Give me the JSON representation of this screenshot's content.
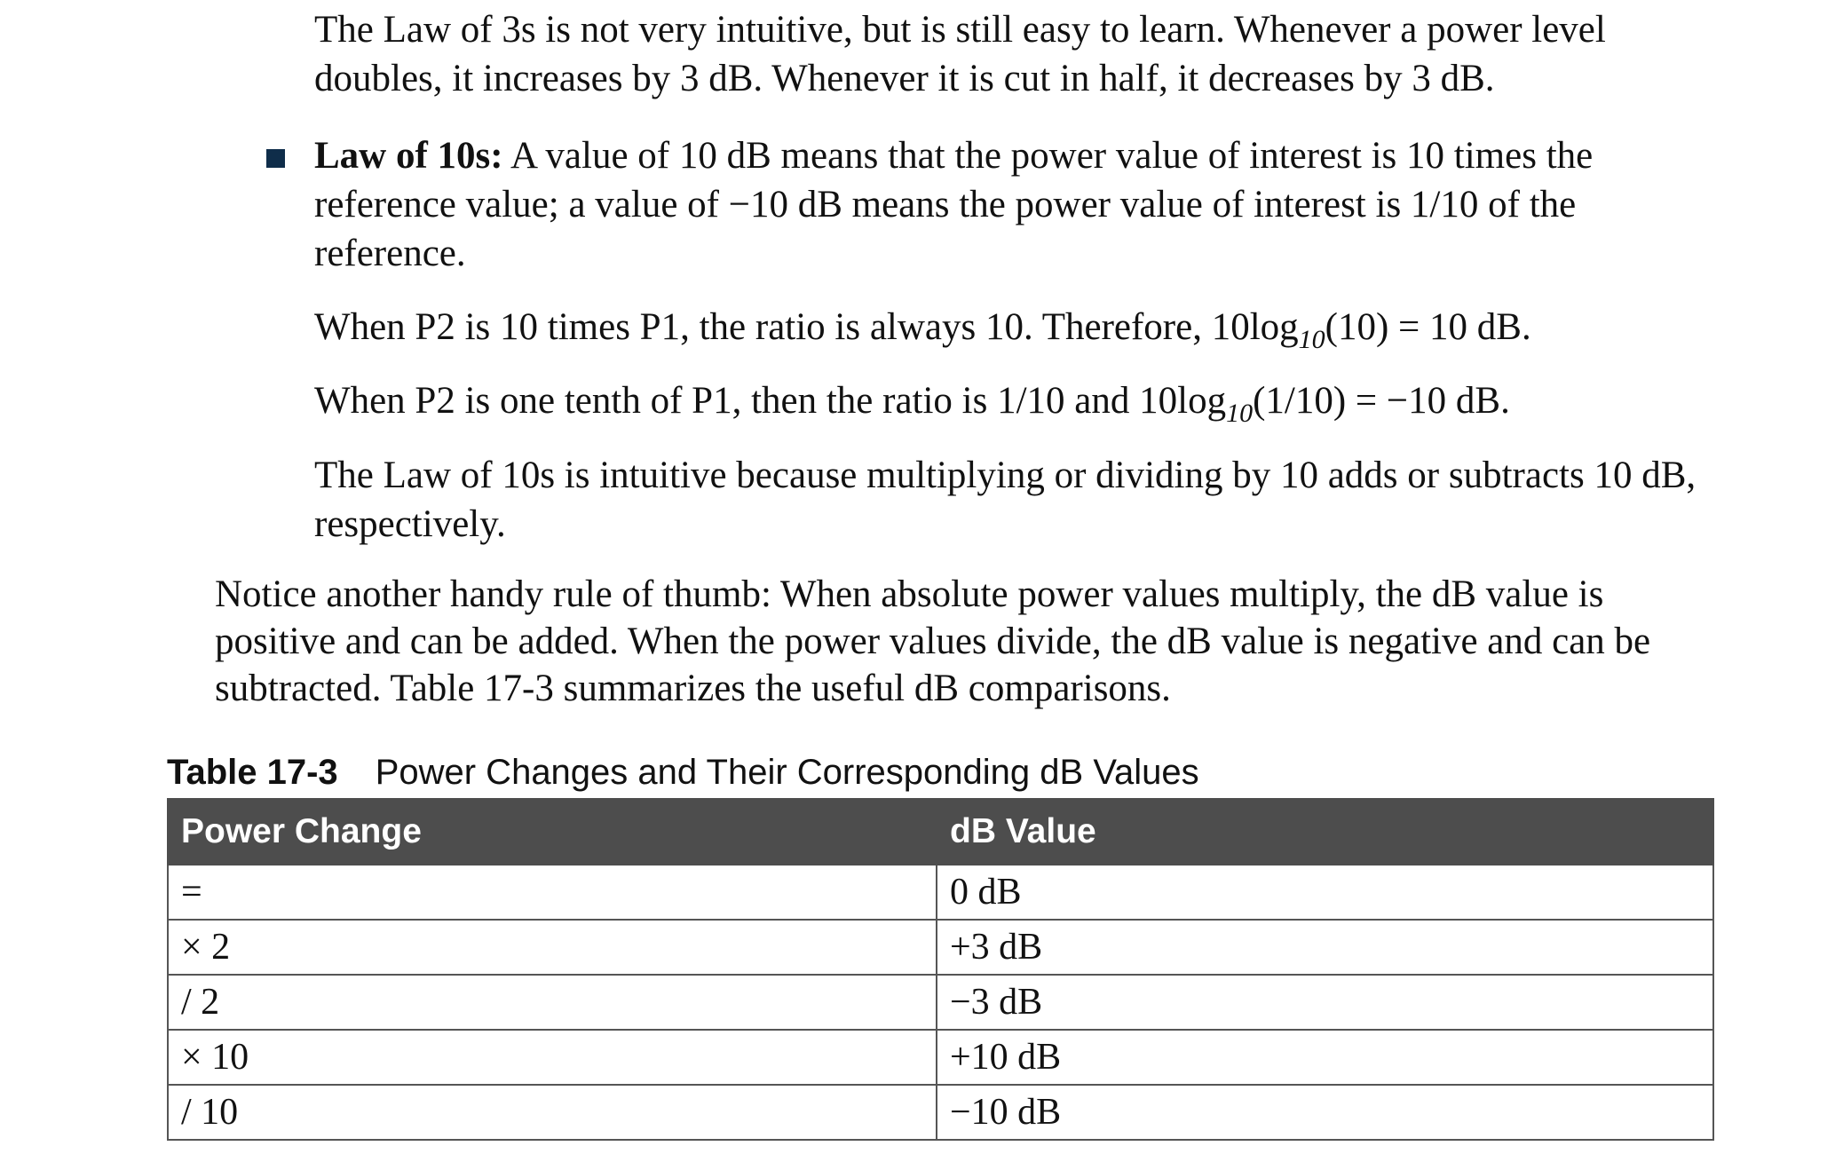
{
  "paragraphs": {
    "law3s_summary": "The Law of 3s is not very intuitive, but is still easy to learn. Whenever a power level doubles, it increases by 3 dB. Whenever it is cut in half, it decreases by 3 dB.",
    "law10s_term": "Law of 10s:",
    "law10s_def": " A value of 10 dB means that the power value of interest is 10 times the reference value; a value of −10 dB means the power value of interest is 1/10 of the reference.",
    "times10_pre": "When P2 is 10 times P1, the ratio is always 10. Therefore, 10log",
    "times10_sub": "10",
    "times10_post": "(10) = 10 dB.",
    "tenth_pre": "When P2 is one tenth of P1, then the ratio is 1/10 and 10log",
    "tenth_sub": "10",
    "tenth_post": "(1/10) = −10 dB.",
    "law10s_summary": "The Law of 10s is intuitive because multiplying or dividing by 10 adds or subtracts 10 dB, respectively.",
    "rule_of_thumb": "Notice another handy rule of thumb: When absolute power values multiply, the dB value is positive and can be added. When the power values divide, the dB value is negative and can be subtracted. Table 17-3 summarizes the useful dB comparisons."
  },
  "table": {
    "caption_label": "Table 17-3",
    "caption_title": "Power Changes and Their Corresponding dB Values",
    "headers": [
      "Power Change",
      "dB Value"
    ],
    "rows": [
      [
        "=",
        "0 dB"
      ],
      [
        "× 2",
        "+3 dB"
      ],
      [
        "/ 2",
        "−3 dB"
      ],
      [
        "× 10",
        "+10 dB"
      ],
      [
        "/ 10",
        "−10 dB"
      ]
    ]
  },
  "colors": {
    "bullet": "#0f2d4a",
    "table_header_bg": "#4d4d4d",
    "table_header_text": "#ffffff"
  }
}
